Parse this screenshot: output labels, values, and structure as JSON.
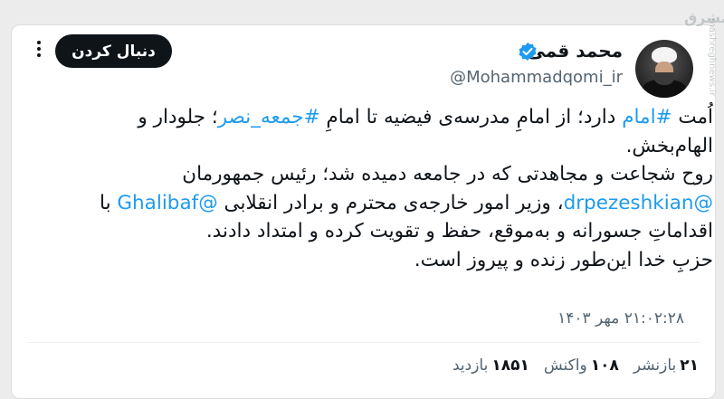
{
  "author": {
    "name": "محمد قمی",
    "handle": "@Mohammadqomi_ir",
    "verified_color": "#1d9bf0"
  },
  "actions": {
    "follow_label": "دنبال کردن",
    "more_icon": "more-dots-icon"
  },
  "tweet": {
    "line1_prefix": "اُمت ",
    "hashtag1": "#امام",
    "line1_mid": " دارد؛ از امامِ مدرسه‌ی فیضیه تا امامِ ",
    "hashtag2": "#جمعه_نصر",
    "line1_suffix": "؛ جلودار و الهام‌بخش.",
    "line2_prefix": "روح شجاعت و مجاهدتی که در جامعه دمیده شد؛ رئیس جمهورمان ",
    "mention1": "@drpezeshkian",
    "line2_mid": "، وزیر امور خارجه‌ی محترم و برادر انقلابی ",
    "mention2": "@Ghalibaf",
    "line2_suffix": " با اقداماتِ جسورانه و به‌موقع، حفظ و تقویت کرده و امتداد دادند.",
    "line3": "حزبِ خدا این‌طور زنده و پیروز است."
  },
  "meta": {
    "timestamp": "۲۱:۰۲:۲۸ مهر ۱۴۰۳"
  },
  "stats": {
    "retweets_count": "۲۱",
    "retweets_label": "بازنشر",
    "reactions_count": "۱۰۸",
    "reactions_label": "واکنش",
    "views_count": "۱۸۵۱",
    "views_label": "بازدید"
  },
  "watermark": {
    "text": "mashreghnews.ir",
    "logo": "مشرق"
  }
}
